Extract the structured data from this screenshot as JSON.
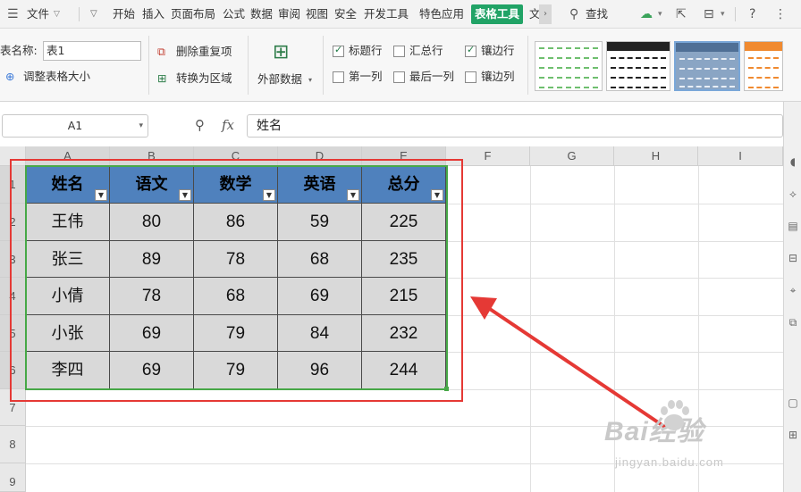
{
  "menubar": {
    "file_menu": "文件",
    "tabs": [
      "开始",
      "插入",
      "页面布局",
      "公式",
      "数据",
      "审阅",
      "视图",
      "安全",
      "开发工具",
      "特色应用",
      "表格工具",
      "文"
    ],
    "active_tab": "表格工具",
    "search_label": "查找"
  },
  "ribbon": {
    "table_name_label": "表名称:",
    "table_name_value": "表1",
    "resize_table": "调整表格大小",
    "remove_duplicates": "删除重复项",
    "convert_to_range": "转换为区域",
    "external_data": "外部数据",
    "options": [
      {
        "label": "标题行",
        "checked": true
      },
      {
        "label": "汇总行",
        "checked": false
      },
      {
        "label": "镶边行",
        "checked": true
      },
      {
        "label": "第一列",
        "checked": false
      },
      {
        "label": "最后一列",
        "checked": false
      },
      {
        "label": "镶边列",
        "checked": false
      }
    ],
    "style_colors": [
      "#6fbf6f",
      "#222222",
      "#6a8fb8",
      "#f08a30"
    ]
  },
  "formula_bar": {
    "cell_ref": "A1",
    "fx": "fx",
    "content": "姓名"
  },
  "sheet": {
    "columns": [
      "A",
      "B",
      "C",
      "D",
      "E",
      "F",
      "G",
      "H",
      "I"
    ],
    "rows": [
      "1",
      "2",
      "3",
      "4",
      "5",
      "6",
      "7",
      "8",
      "9"
    ],
    "table": {
      "headers": [
        "姓名",
        "语文",
        "数学",
        "英语",
        "总分"
      ],
      "rows": [
        [
          "王伟",
          "80",
          "86",
          "59",
          "225"
        ],
        [
          "张三",
          "89",
          "78",
          "68",
          "235"
        ],
        [
          "小倩",
          "78",
          "68",
          "69",
          "215"
        ],
        [
          "小张",
          "69",
          "79",
          "84",
          "232"
        ],
        [
          "李四",
          "69",
          "79",
          "96",
          "244"
        ]
      ]
    }
  },
  "watermark": {
    "main": "Bai经验",
    "sub": "jingyan.baidu.com"
  },
  "colors": {
    "active_tab": "#21a366",
    "table_header": "#4f81bd",
    "table_band": "#d9d9d9",
    "table_outline": "#47a847",
    "annotation": "#e53935"
  }
}
